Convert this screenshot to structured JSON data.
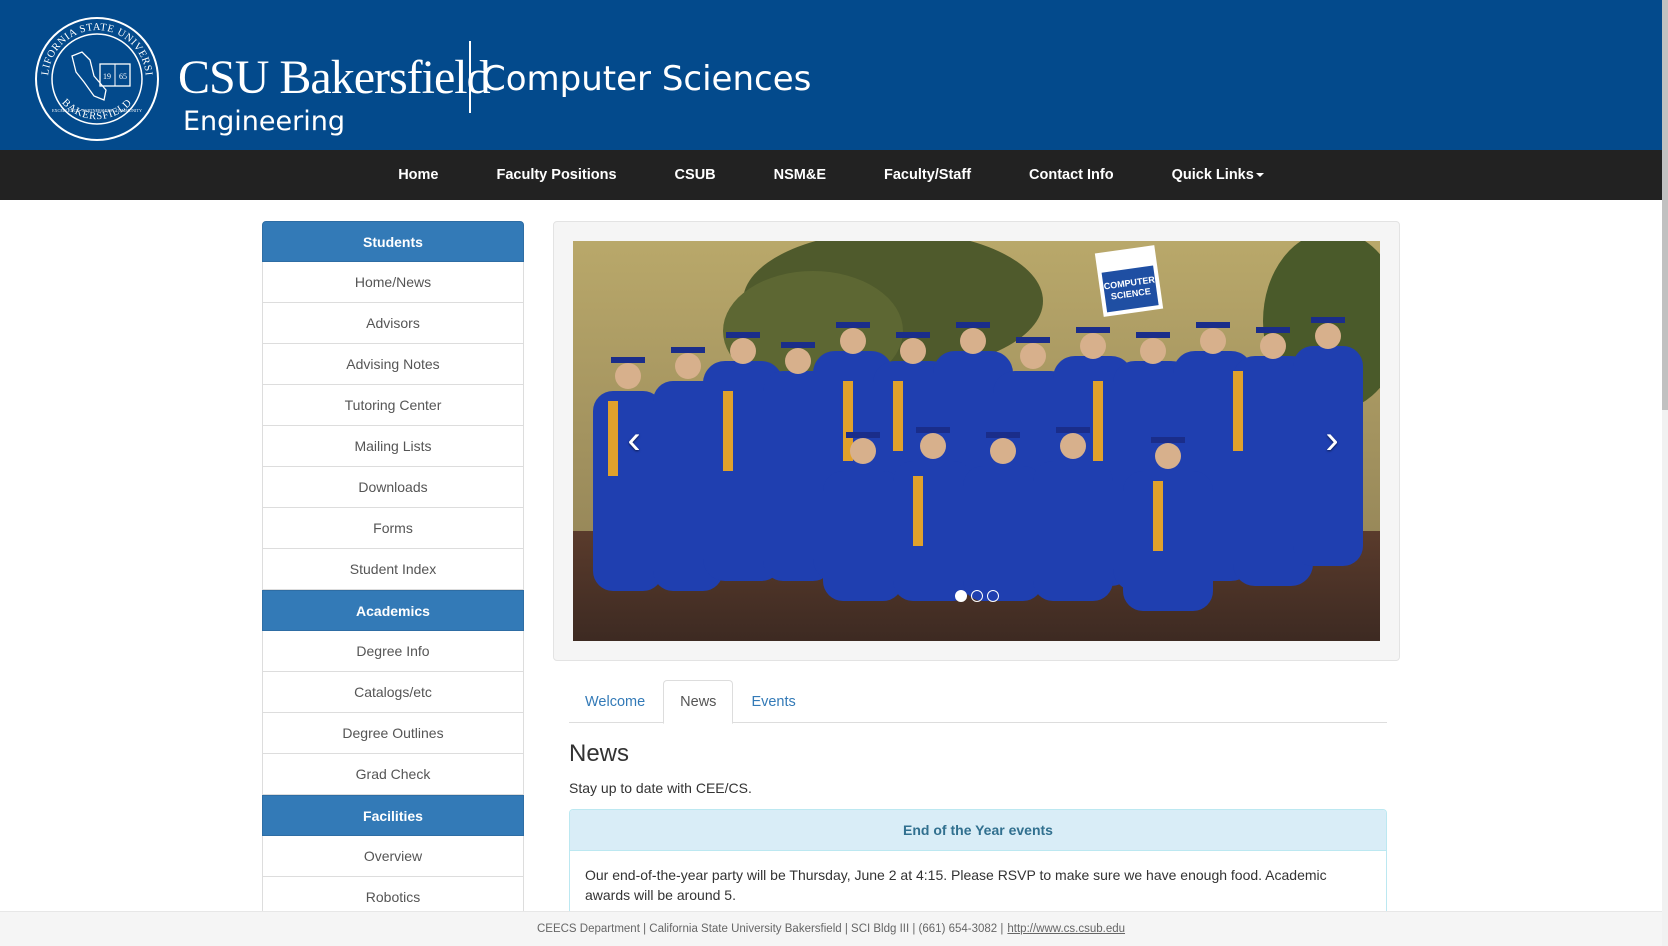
{
  "header": {
    "seal_text_top": "CALIFORNIA STATE UNIVERSITY",
    "seal_text_bottom": "BAKERSFIELD",
    "seal_year_left": "19",
    "seal_year_right": "65",
    "seal_motto": "EXCELLENCE · PARTNERSHIPS · COMMUNITY",
    "university": "CSU Bakersfield",
    "school": "Engineering",
    "department": "Computer Sciences",
    "color": "#034a8c"
  },
  "nav": {
    "items": [
      "Home",
      "Faculty Positions",
      "CSUB",
      "NSM&E",
      "Faculty/Staff",
      "Contact Info"
    ],
    "dropdown": "Quick Links"
  },
  "sidebar": {
    "students_heading": "Students",
    "students": [
      "Home/News",
      "Advisors",
      "Advising Notes",
      "Tutoring Center",
      "Mailing Lists",
      "Downloads",
      "Forms",
      "Student Index"
    ],
    "academics_heading": "Academics",
    "academics": [
      "Degree Info",
      "Catalogs/etc",
      "Degree Outlines",
      "Grad Check"
    ],
    "facilities_heading": "Facilities",
    "facilities": [
      "Overview",
      "Robotics"
    ],
    "accent": "#337ab7"
  },
  "carousel": {
    "sign_text_1": "COMPUTER",
    "sign_text_2": "SCIENCE",
    "prev_icon": "chevron-left-icon",
    "next_icon": "chevron-right-icon",
    "slide_count": 3,
    "active_slide": 1
  },
  "tabs": {
    "items": [
      "Welcome",
      "News",
      "Events"
    ],
    "active": "News"
  },
  "news": {
    "title": "News",
    "subtitle": "Stay up to date with CEE/CS.",
    "panel_title": "End of the Year events",
    "panel_body": "Our end-of-the-year party will be Thursday, June 2 at 4:15. Please RSVP to make sure we have enough food. Academic awards will be around 5."
  },
  "footer": {
    "text": "CEECS Department | California State University Bakersfield | SCI Bldg III | (661) 654-3082 |",
    "link": "http://www.cs.csub.edu"
  }
}
